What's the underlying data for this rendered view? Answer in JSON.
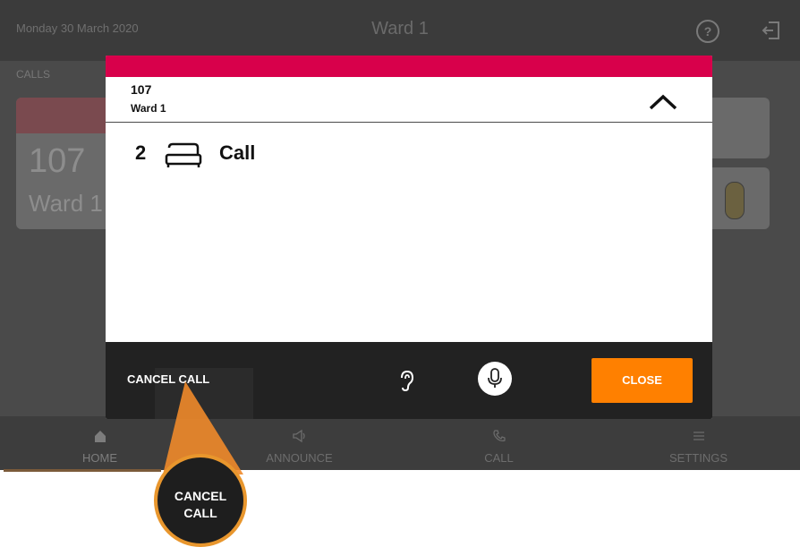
{
  "header": {
    "date": "Monday 30 March 2020",
    "title": "Ward 1",
    "help_icon": "?"
  },
  "calls_section": {
    "label": "CALLS",
    "card": {
      "number": "107",
      "ward": "Ward 1"
    }
  },
  "modal": {
    "accent_color": "#d8004b",
    "room_number": "107",
    "ward": "Ward 1",
    "call": {
      "count": "2",
      "icon": "bed-icon",
      "label": "Call"
    },
    "footer": {
      "cancel_label": "CANCEL CALL",
      "listen_icon": "ear-icon",
      "mic_icon": "microphone-icon",
      "close_label": "CLOSE",
      "close_color": "#ff8000"
    }
  },
  "nav": {
    "items": [
      {
        "label": "HOME",
        "icon": "home-icon"
      },
      {
        "label": "ANNOUNCE",
        "icon": "megaphone-icon"
      },
      {
        "label": "CALL",
        "icon": "phone-icon"
      },
      {
        "label": "SETTINGS",
        "icon": "menu-icon"
      }
    ]
  },
  "callout": {
    "line1": "CANCEL",
    "line2": "CALL",
    "border_color": "#e8962d"
  }
}
